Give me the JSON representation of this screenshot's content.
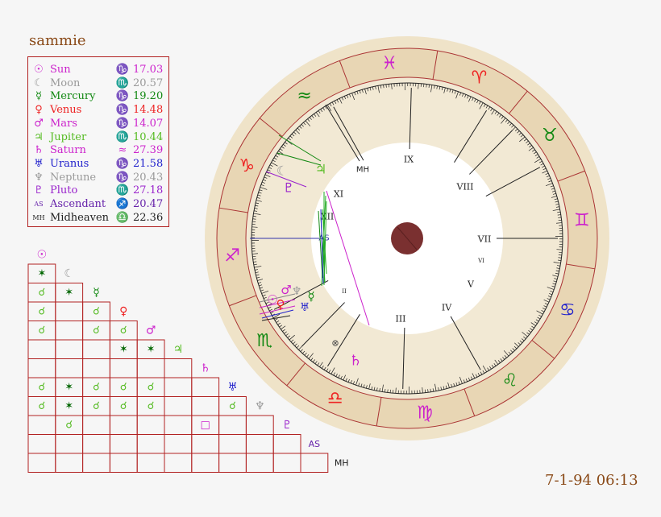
{
  "chart_name": "sammie",
  "date_time": "7-1-94 06:13",
  "points": [
    {
      "key": "sun",
      "glyph": "☉",
      "name": "Sun",
      "sign_glyph": "♑",
      "degree": "17.03",
      "color": "#cc22cc"
    },
    {
      "key": "moon",
      "glyph": "☾",
      "name": "Moon",
      "sign_glyph": "♏",
      "degree": "20.57",
      "color": "#999999"
    },
    {
      "key": "mercury",
      "glyph": "☿",
      "name": "Mercury",
      "sign_glyph": "♑",
      "degree": "19.20",
      "color": "#118811"
    },
    {
      "key": "venus",
      "glyph": "♀",
      "name": "Venus",
      "sign_glyph": "♑",
      "degree": "14.48",
      "color": "#ee2222"
    },
    {
      "key": "mars",
      "glyph": "♂",
      "name": "Mars",
      "sign_glyph": "♑",
      "degree": "14.07",
      "color": "#cc22cc"
    },
    {
      "key": "jupiter",
      "glyph": "♃",
      "name": "Jupiter",
      "sign_glyph": "♏",
      "degree": "10.44",
      "color": "#55bb22"
    },
    {
      "key": "saturn",
      "glyph": "♄",
      "name": "Saturn",
      "sign_glyph": "≈",
      "degree": "27.39",
      "color": "#cc22cc"
    },
    {
      "key": "uranus",
      "glyph": "♅",
      "name": "Uranus",
      "sign_glyph": "♑",
      "degree": "21.58",
      "color": "#2222cc"
    },
    {
      "key": "neptune",
      "glyph": "♆",
      "name": "Neptune",
      "sign_glyph": "♑",
      "degree": "20.43",
      "color": "#999999"
    },
    {
      "key": "pluto",
      "glyph": "♇",
      "name": "Pluto",
      "sign_glyph": "♏",
      "degree": "27.18",
      "color": "#9922cc"
    },
    {
      "key": "ascendant",
      "glyph": "AS",
      "name": "Ascendant",
      "sign_glyph": "♐",
      "degree": "20.47",
      "color": "#6622aa"
    },
    {
      "key": "midheaven",
      "glyph": "MH",
      "name": "Midheaven",
      "sign_glyph": "♎",
      "degree": "22.36",
      "color": "#222222"
    }
  ],
  "aspect_grid": {
    "labels": [
      "☉",
      "☾",
      "☿",
      "♀",
      "♂",
      "♃",
      "♄",
      "♅",
      "♆",
      "♇",
      "AS",
      "MH"
    ],
    "label_colors": [
      "#cc22cc",
      "#999999",
      "#118811",
      "#ee2222",
      "#cc22cc",
      "#55bb22",
      "#cc22cc",
      "#2222cc",
      "#999999",
      "#9922cc",
      "#6622aa",
      "#222222"
    ],
    "cells": [
      {
        "row": 1,
        "col": 0,
        "glyph": "✶",
        "color": "#006600"
      },
      {
        "row": 2,
        "col": 0,
        "glyph": "☌",
        "color": "#55bb22"
      },
      {
        "row": 2,
        "col": 1,
        "glyph": "✶",
        "color": "#006600"
      },
      {
        "row": 3,
        "col": 0,
        "glyph": "☌",
        "color": "#55bb22"
      },
      {
        "row": 3,
        "col": 2,
        "glyph": "☌",
        "color": "#55bb22"
      },
      {
        "row": 4,
        "col": 0,
        "glyph": "☌",
        "color": "#55bb22"
      },
      {
        "row": 4,
        "col": 2,
        "glyph": "☌",
        "color": "#55bb22"
      },
      {
        "row": 4,
        "col": 3,
        "glyph": "☌",
        "color": "#55bb22"
      },
      {
        "row": 5,
        "col": 3,
        "glyph": "✶",
        "color": "#006600"
      },
      {
        "row": 5,
        "col": 4,
        "glyph": "✶",
        "color": "#006600"
      },
      {
        "row": 7,
        "col": 0,
        "glyph": "☌",
        "color": "#55bb22"
      },
      {
        "row": 7,
        "col": 1,
        "glyph": "✶",
        "color": "#006600"
      },
      {
        "row": 7,
        "col": 2,
        "glyph": "☌",
        "color": "#55bb22"
      },
      {
        "row": 7,
        "col": 3,
        "glyph": "☌",
        "color": "#55bb22"
      },
      {
        "row": 7,
        "col": 4,
        "glyph": "☌",
        "color": "#55bb22"
      },
      {
        "row": 8,
        "col": 0,
        "glyph": "☌",
        "color": "#55bb22"
      },
      {
        "row": 8,
        "col": 1,
        "glyph": "✶",
        "color": "#006600"
      },
      {
        "row": 8,
        "col": 2,
        "glyph": "☌",
        "color": "#55bb22"
      },
      {
        "row": 8,
        "col": 3,
        "glyph": "☌",
        "color": "#55bb22"
      },
      {
        "row": 8,
        "col": 4,
        "glyph": "☌",
        "color": "#55bb22"
      },
      {
        "row": 8,
        "col": 7,
        "glyph": "☌",
        "color": "#55bb22"
      },
      {
        "row": 9,
        "col": 1,
        "glyph": "☌",
        "color": "#55bb22"
      },
      {
        "row": 9,
        "col": 6,
        "glyph": "□",
        "color": "#cc22cc"
      }
    ]
  },
  "wheel": {
    "signs": [
      {
        "glyph": "♎",
        "color": "#ee2222"
      },
      {
        "glyph": "♍",
        "color": "#cc22cc"
      },
      {
        "glyph": "♌",
        "color": "#118811"
      },
      {
        "glyph": "♋",
        "color": "#2222cc"
      },
      {
        "glyph": "♊",
        "color": "#cc22cc"
      },
      {
        "glyph": "♉",
        "color": "#118811"
      },
      {
        "glyph": "♈",
        "color": "#ee2222"
      },
      {
        "glyph": "♓",
        "color": "#cc22cc"
      },
      {
        "glyph": "≈",
        "color": "#118811"
      },
      {
        "glyph": "♑",
        "color": "#ee2222"
      },
      {
        "glyph": "♐",
        "color": "#cc22cc"
      },
      {
        "glyph": "♏",
        "color": "#118811"
      }
    ],
    "houses": [
      "IX",
      "VIII",
      "VII",
      "VI",
      "V",
      "IV",
      "III",
      "II",
      "XII",
      "XI"
    ],
    "as_label": "AS",
    "mh_label": "MH",
    "pof_glyph": "⊗",
    "planet_glyphs": {
      "moon": "☾",
      "jupiter": "♃",
      "pluto": "♇",
      "mercury": "☿",
      "saturn": "♄",
      "sun": "☉",
      "mars": "♂",
      "venus": "♀",
      "uranus": "♅",
      "neptune": "♆"
    }
  }
}
